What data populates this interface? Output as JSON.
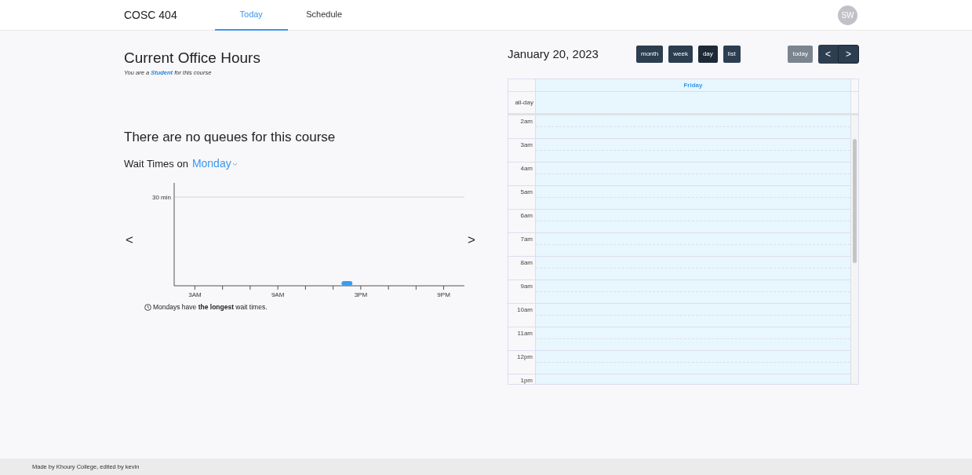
{
  "nav": {
    "course": "COSC 404",
    "tabs": [
      {
        "label": "Today",
        "selected": true
      },
      {
        "label": "Schedule",
        "selected": false
      }
    ],
    "avatar": "SW"
  },
  "office_hours": {
    "title": "Current Office Hours",
    "role_note": "You are a **Student** for this course"
  },
  "queues": {
    "message": "There are no queues for this course"
  },
  "wait_times": {
    "label": "Wait Times on",
    "day": "Monday",
    "prev": "<",
    "next": ">",
    "chart": {
      "y_label": "30 min",
      "x_labels": [
        "3AM",
        "9AM",
        "3PM",
        "9PM"
      ]
    },
    "note": "Mondays have **the longest** wait times."
  },
  "calendar": {
    "title": "January 20, 2023",
    "views": [
      {
        "label": "month",
        "selected": false
      },
      {
        "label": "week",
        "selected": false
      },
      {
        "label": "day",
        "selected": true
      },
      {
        "label": "list",
        "selected": false
      }
    ],
    "today": {
      "label": "today",
      "disabled": true
    },
    "prev": "<",
    "next": ">",
    "day_header": "Friday",
    "all_day": "all-day",
    "hours": [
      "2am",
      "3am",
      "4am",
      "5am",
      "6am",
      "7am",
      "8am",
      "9am",
      "10am",
      "11am",
      "12pm",
      "1pm"
    ]
  },
  "footer": "Made by Khoury College, edited by kevin"
}
